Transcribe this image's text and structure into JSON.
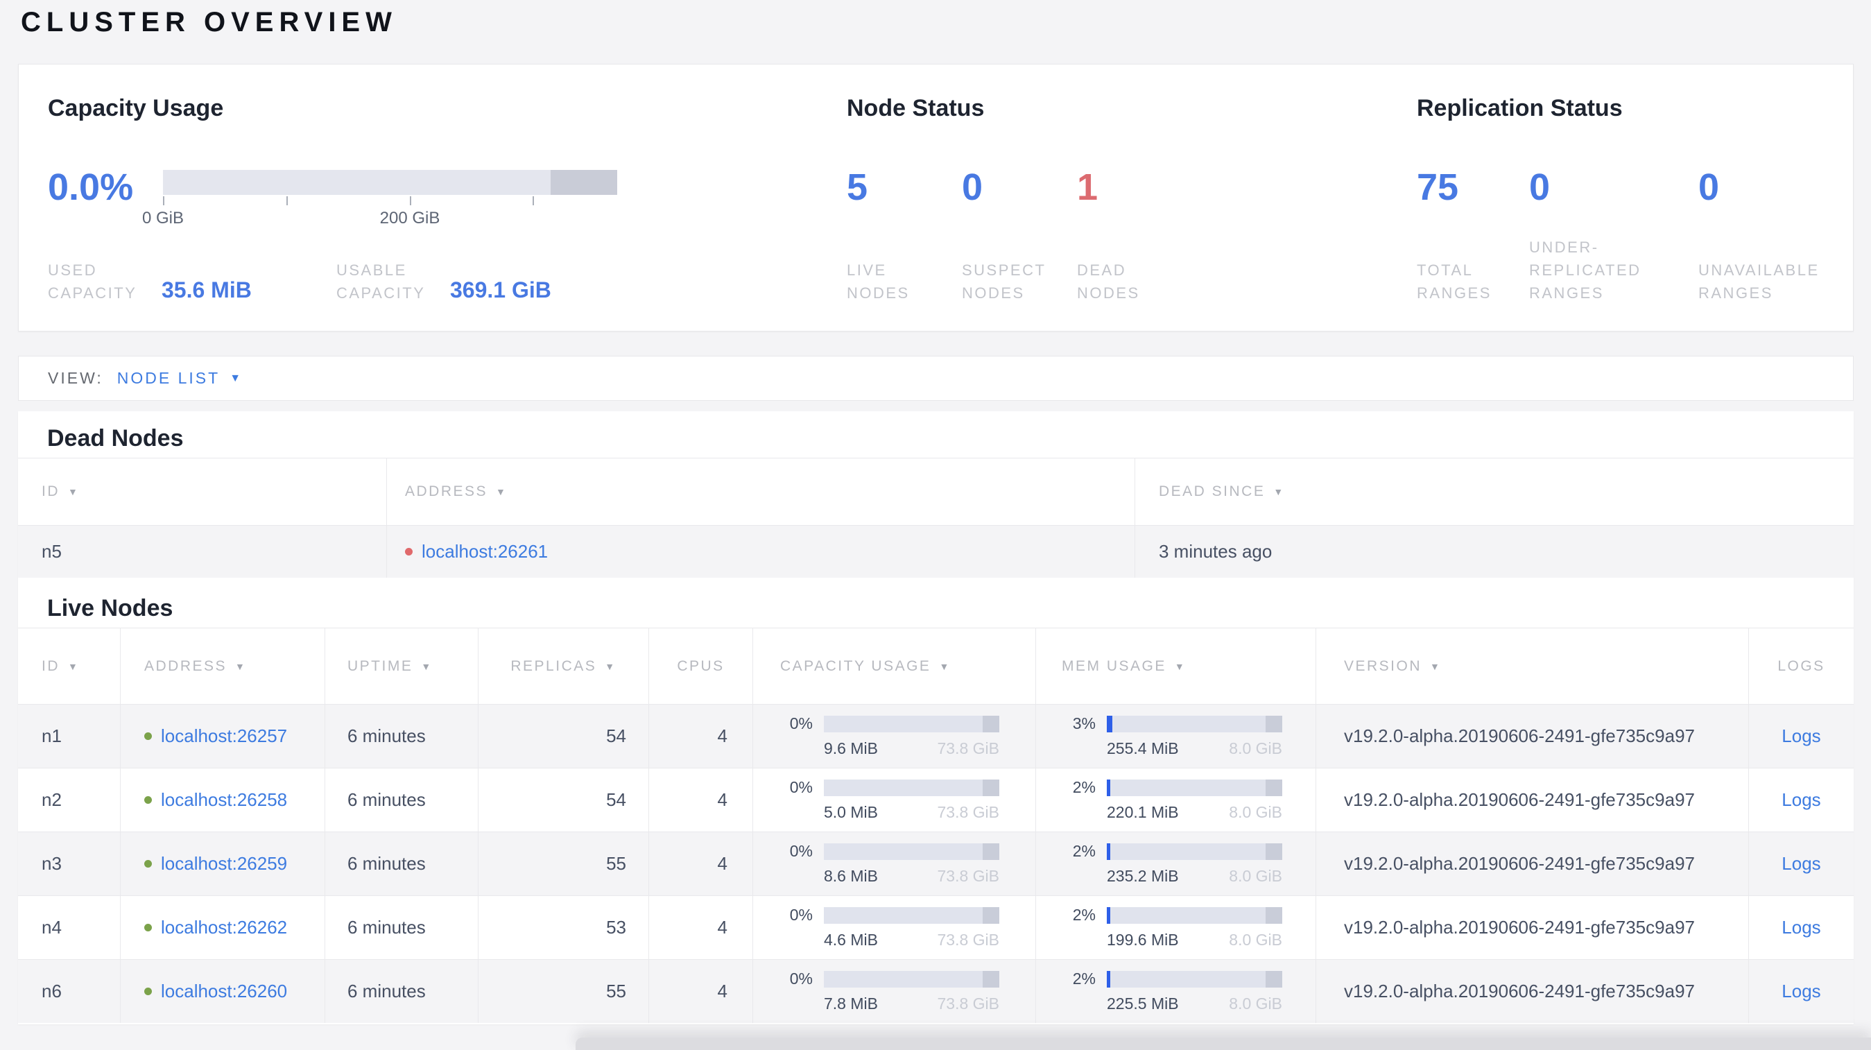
{
  "page": {
    "title": "CLUSTER OVERVIEW"
  },
  "icons": {
    "sort_desc": "▼",
    "caret_down": "▼"
  },
  "colors": {
    "accent_blue": "#4879e2",
    "link_blue": "#3d7be0",
    "alert_red": "#dc6b70",
    "live_green": "#7ba24a",
    "bar_track": "#e0e3ed",
    "bar_reserved": "#c9cdd9",
    "bar_fill": "#2e5fe8"
  },
  "bars": {
    "cell_reserved_pct": "9.5%"
  },
  "overview": {
    "capacity": {
      "heading": "Capacity Usage",
      "percent": "0.0%",
      "bar": {
        "fill_pct": "0%",
        "reserved_pct": "14.7%"
      },
      "tick_labels": [
        "0 GiB",
        "200 GiB"
      ],
      "stats": [
        {
          "label": "USED CAPACITY",
          "value": "35.6 MiB"
        },
        {
          "label": "USABLE CAPACITY",
          "value": "369.1 GiB"
        }
      ]
    },
    "nodes": {
      "heading": "Node Status",
      "stats": [
        {
          "value": "5",
          "label": "LIVE NODES"
        },
        {
          "value": "0",
          "label": "SUSPECT NODES"
        },
        {
          "value": "1",
          "label": "DEAD NODES"
        }
      ]
    },
    "replication": {
      "heading": "Replication Status",
      "stats": [
        {
          "value": "75",
          "label": "TOTAL RANGES"
        },
        {
          "value": "0",
          "label": "UNDER-REPLICATED RANGES"
        },
        {
          "value": "0",
          "label": "UNAVAILABLE RANGES"
        }
      ]
    }
  },
  "view_bar": {
    "label": "VIEW:",
    "selected": "NODE LIST"
  },
  "dead_nodes": {
    "heading": "Dead Nodes",
    "columns": [
      {
        "label": "ID"
      },
      {
        "label": "ADDRESS"
      },
      {
        "label": "DEAD SINCE"
      }
    ],
    "rows": [
      {
        "id": "n5",
        "address": "localhost:26261",
        "dead_since": "3 minutes ago"
      }
    ]
  },
  "live_nodes": {
    "heading": "Live Nodes",
    "logs_label": "Logs",
    "columns": [
      {
        "label": "ID"
      },
      {
        "label": "ADDRESS"
      },
      {
        "label": "UPTIME"
      },
      {
        "label": "REPLICAS"
      },
      {
        "label": "CPUS"
      },
      {
        "label": "CAPACITY USAGE"
      },
      {
        "label": "MEM USAGE"
      },
      {
        "label": "VERSION"
      },
      {
        "label": "LOGS"
      }
    ],
    "rows": [
      {
        "id": "n1",
        "address": "localhost:26257",
        "uptime": "6 minutes",
        "replicas": "54",
        "cpus": "4",
        "capacity": {
          "percent": "0%",
          "fill_pct": "0%",
          "used": "9.6 MiB",
          "total": "73.8 GiB"
        },
        "memory": {
          "percent": "3%",
          "fill_pct": "3%",
          "used": "255.4 MiB",
          "total": "8.0 GiB"
        },
        "version": "v19.2.0-alpha.20190606-2491-gfe735c9a97"
      },
      {
        "id": "n2",
        "address": "localhost:26258",
        "uptime": "6 minutes",
        "replicas": "54",
        "cpus": "4",
        "capacity": {
          "percent": "0%",
          "fill_pct": "0%",
          "used": "5.0 MiB",
          "total": "73.8 GiB"
        },
        "memory": {
          "percent": "2%",
          "fill_pct": "2%",
          "used": "220.1 MiB",
          "total": "8.0 GiB"
        },
        "version": "v19.2.0-alpha.20190606-2491-gfe735c9a97"
      },
      {
        "id": "n3",
        "address": "localhost:26259",
        "uptime": "6 minutes",
        "replicas": "55",
        "cpus": "4",
        "capacity": {
          "percent": "0%",
          "fill_pct": "0%",
          "used": "8.6 MiB",
          "total": "73.8 GiB"
        },
        "memory": {
          "percent": "2%",
          "fill_pct": "2%",
          "used": "235.2 MiB",
          "total": "8.0 GiB"
        },
        "version": "v19.2.0-alpha.20190606-2491-gfe735c9a97"
      },
      {
        "id": "n4",
        "address": "localhost:26262",
        "uptime": "6 minutes",
        "replicas": "53",
        "cpus": "4",
        "capacity": {
          "percent": "0%",
          "fill_pct": "0%",
          "used": "4.6 MiB",
          "total": "73.8 GiB"
        },
        "memory": {
          "percent": "2%",
          "fill_pct": "2%",
          "used": "199.6 MiB",
          "total": "8.0 GiB"
        },
        "version": "v19.2.0-alpha.20190606-2491-gfe735c9a97"
      },
      {
        "id": "n6",
        "address": "localhost:26260",
        "uptime": "6 minutes",
        "replicas": "55",
        "cpus": "4",
        "capacity": {
          "percent": "0%",
          "fill_pct": "0%",
          "used": "7.8 MiB",
          "total": "73.8 GiB"
        },
        "memory": {
          "percent": "2%",
          "fill_pct": "2%",
          "used": "225.5 MiB",
          "total": "8.0 GiB"
        },
        "version": "v19.2.0-alpha.20190606-2491-gfe735c9a97"
      }
    ]
  }
}
